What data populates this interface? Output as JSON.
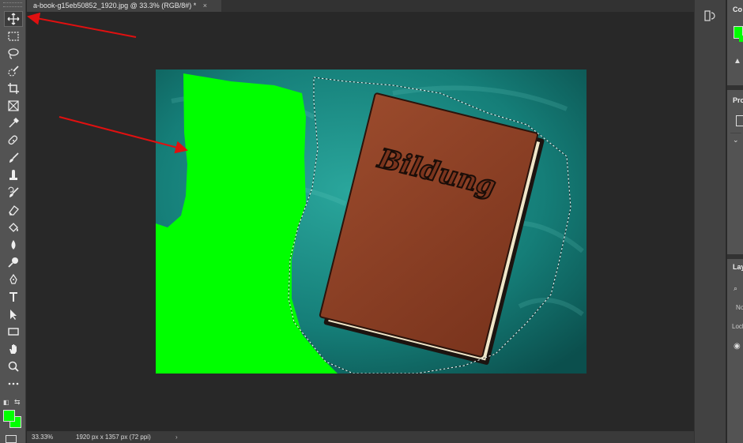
{
  "document": {
    "tab_title": "a-book-g15eb50852_1920.jpg @ 33.3% (RGB/8#) *",
    "close_glyph": "×"
  },
  "status": {
    "zoom": "33.33%",
    "doc_size": "1920 px x 1357 px (72 ppi)",
    "arrow": "›"
  },
  "artwork": {
    "book_title": "Bildung"
  },
  "colors": {
    "foreground": "#00ff00",
    "background": "#00ff00",
    "canvas_teal": "#157e78",
    "book_cover": "#8a3e23",
    "annotation_arrow": "#e01010"
  },
  "tools": [
    {
      "name": "move-tool",
      "icon": "move-icon",
      "active": true
    },
    {
      "name": "marquee-tool",
      "icon": "rect-marquee-icon"
    },
    {
      "name": "lasso-tool",
      "icon": "lasso-icon"
    },
    {
      "name": "quick-selection-tool",
      "icon": "quick-selection-icon"
    },
    {
      "name": "crop-tool",
      "icon": "crop-icon"
    },
    {
      "name": "frame-tool",
      "icon": "frame-icon"
    },
    {
      "name": "eyedropper-tool",
      "icon": "eyedropper-icon"
    },
    {
      "name": "healing-brush-tool",
      "icon": "bandage-icon"
    },
    {
      "name": "brush-tool",
      "icon": "brush-icon"
    },
    {
      "name": "clone-stamp-tool",
      "icon": "stamp-icon"
    },
    {
      "name": "history-brush-tool",
      "icon": "history-brush-icon"
    },
    {
      "name": "eraser-tool",
      "icon": "eraser-icon"
    },
    {
      "name": "paint-bucket-tool",
      "icon": "paint-bucket-icon"
    },
    {
      "name": "blur-tool",
      "icon": "drop-icon"
    },
    {
      "name": "dodge-tool",
      "icon": "dodge-icon"
    },
    {
      "name": "pen-tool",
      "icon": "pen-icon"
    },
    {
      "name": "type-tool",
      "icon": "type-icon"
    },
    {
      "name": "path-selection-tool",
      "icon": "arrow-cursor-icon"
    },
    {
      "name": "rectangle-tool",
      "icon": "rectangle-icon"
    },
    {
      "name": "hand-tool",
      "icon": "hand-icon"
    },
    {
      "name": "zoom-tool",
      "icon": "magnifier-icon"
    },
    {
      "name": "edit-toolbar",
      "icon": "more-icon"
    }
  ],
  "panels": {
    "color_title": "Co",
    "properties_title": "Pro",
    "layers_title": "Lay",
    "blend_mode": "No",
    "lock_label": "Lock"
  }
}
